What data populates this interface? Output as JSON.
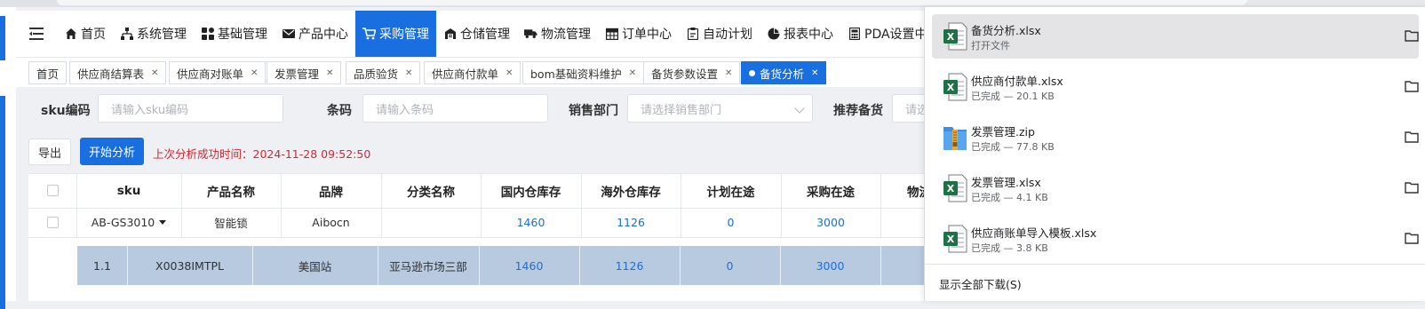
{
  "nav": {
    "items": [
      {
        "label": "首页",
        "icon": "home-icon"
      },
      {
        "label": "系统管理",
        "icon": "sitemap-icon"
      },
      {
        "label": "基础管理",
        "icon": "grid-icon"
      },
      {
        "label": "产品中心",
        "icon": "mail-icon"
      },
      {
        "label": "采购管理",
        "icon": "cart-icon",
        "active": true
      },
      {
        "label": "仓储管理",
        "icon": "warehouse-icon"
      },
      {
        "label": "物流管理",
        "icon": "truck-icon"
      },
      {
        "label": "订单中心",
        "icon": "table-icon"
      },
      {
        "label": "自动计划",
        "icon": "clipboard-icon"
      },
      {
        "label": "报表中心",
        "icon": "pie-chart-icon"
      },
      {
        "label": "PDA设置中心",
        "icon": "calculator-icon"
      }
    ]
  },
  "tabs": [
    {
      "label": "首页",
      "closable": false
    },
    {
      "label": "供应商结算表",
      "closable": true
    },
    {
      "label": "供应商对账单",
      "closable": true
    },
    {
      "label": "发票管理",
      "closable": true
    },
    {
      "label": "品质验货",
      "closable": true
    },
    {
      "label": "供应商付款单",
      "closable": true
    },
    {
      "label": "bom基础资料维护",
      "closable": true
    },
    {
      "label": "备货参数设置",
      "closable": true
    },
    {
      "label": "备货分析",
      "closable": true,
      "active": true
    }
  ],
  "filters": {
    "sku_label": "sku编码",
    "sku_placeholder": "请输入sku编码",
    "barcode_label": "条码",
    "barcode_placeholder": "请输入条码",
    "dept_label": "销售部门",
    "dept_placeholder": "请选择销售部门",
    "rec_label": "推荐备货",
    "rec_placeholder": "请选"
  },
  "actions": {
    "export": "导出",
    "start": "开始分析",
    "last_time_label": "上次分析成功时间：",
    "last_time_value": "2024-11-28 09:52:50"
  },
  "table": {
    "headers": [
      "sku",
      "产品名称",
      "品牌",
      "分类名称",
      "国内仓库存",
      "海外仓库存",
      "计划在途",
      "采购在途",
      "物流"
    ],
    "row": {
      "sku": "AB-GS3010",
      "name": "智能锁",
      "brand": "Aibocn",
      "category": "",
      "domestic": "1460",
      "overseas": "1126",
      "planned": "0",
      "purchase": "3000"
    },
    "subrow": {
      "index": "1.1",
      "code": "X0038IMTPL",
      "site": "美国站",
      "dept": "亚马逊市场三部",
      "domestic": "1460",
      "overseas": "1126",
      "planned": "0",
      "purchase": "3000"
    }
  },
  "downloads": {
    "items": [
      {
        "name": "备货分析.xlsx",
        "status": "打开文件",
        "type": "excel"
      },
      {
        "name": "供应商付款单.xlsx",
        "status": "已完成 — 20.1 KB",
        "type": "excel"
      },
      {
        "name": "发票管理.zip",
        "status": "已完成 — 77.8 KB",
        "type": "zip"
      },
      {
        "name": "发票管理.xlsx",
        "status": "已完成 — 4.1 KB",
        "type": "excel"
      },
      {
        "name": "供应商账单导入模板.xlsx",
        "status": "已完成 — 3.8 KB",
        "type": "excel"
      }
    ],
    "show_all": "显示全部下载(S)"
  },
  "colors": {
    "accent": "#1a6fe0",
    "alert": "#e0232b",
    "subrow": "#b7cae0",
    "excel": "#1e7145"
  }
}
